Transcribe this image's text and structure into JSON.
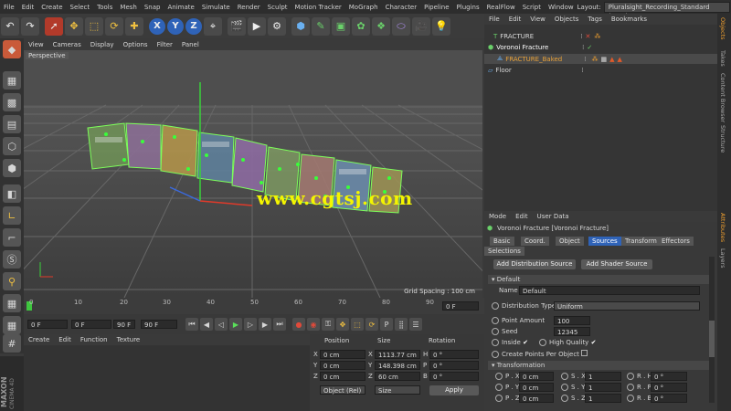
{
  "menubar": {
    "items": [
      "File",
      "Edit",
      "Create",
      "Select",
      "Tools",
      "Mesh",
      "Snap",
      "Animate",
      "Simulate",
      "Render",
      "Sculpt",
      "Motion Tracker",
      "MoGraph",
      "Character",
      "Pipeline",
      "Plugins",
      "RealFlow",
      "Script",
      "Window"
    ],
    "layout_label": "Layout:",
    "layout_value": "Pluralsight_Recording_Standard (User)"
  },
  "toolbar": {
    "x": "X",
    "y": "Y",
    "z": "Z"
  },
  "view_menu": [
    "View",
    "Cameras",
    "Display",
    "Options",
    "Filter",
    "Panel"
  ],
  "viewport": {
    "label": "Perspective",
    "grid_spacing": "Grid Spacing : 100 cm",
    "watermark": "www.cgtsj.com",
    "text3d": "FRACTURE"
  },
  "timeline": {
    "ticks": [
      "0",
      "10",
      "20",
      "30",
      "40",
      "50",
      "60",
      "70",
      "80",
      "90"
    ],
    "end_field": "0 F"
  },
  "transport": {
    "f1": "0 F",
    "f2": "0 F",
    "f3": "90 F",
    "f4": "90 F"
  },
  "material": {
    "menu": [
      "Create",
      "Edit",
      "Function",
      "Texture"
    ],
    "brand1": "MAXON",
    "brand2": "CINEMA 4D"
  },
  "coords": {
    "headers": [
      "Position",
      "Size",
      "Rotation"
    ],
    "rows": [
      {
        "a": "X",
        "p": "0 cm",
        "b": "X",
        "s": "1113.77 cm",
        "c": "H",
        "r": "0 °"
      },
      {
        "a": "Y",
        "p": "0 cm",
        "b": "Y",
        "s": "148.398 cm",
        "c": "P",
        "r": "0 °"
      },
      {
        "a": "Z",
        "p": "0 cm",
        "b": "Z",
        "s": "60 cm",
        "c": "B",
        "r": "0 °"
      }
    ],
    "mode": "Object (Rel)",
    "size_mode": "Size",
    "apply": "Apply"
  },
  "objects": {
    "menu": [
      "File",
      "Edit",
      "View",
      "Objects",
      "Tags",
      "Bookmarks"
    ],
    "items": [
      {
        "name": "FRACTURE",
        "color": "#d8d8d8"
      },
      {
        "name": "Voronoi Fracture",
        "color": "#ffffff"
      },
      {
        "name": "FRACTURE_Baked",
        "color": "#e8a23a"
      },
      {
        "name": "Floor",
        "color": "#d8d8d8"
      }
    ]
  },
  "attributes": {
    "menu": [
      "Mode",
      "Edit",
      "User Data"
    ],
    "title": "Voronoi Fracture [Voronoi Fracture]",
    "tabs": [
      "Basic",
      "Coord.",
      "Object",
      "Sources",
      "Transform",
      "Effectors",
      "Selections"
    ],
    "add_dist": "Add Distribution Source",
    "add_shader": "Add Shader Source",
    "section_default": "Default",
    "name_label": "Name",
    "name_value": "Default",
    "dist_type_label": "Distribution Type",
    "dist_type_value": "Uniform",
    "point_amount_label": "Point Amount",
    "point_amount": "100",
    "seed_label": "Seed",
    "seed": "12345",
    "inside_label": "Inside",
    "hq_label": "High Quality",
    "create_points_label": "Create Points Per Object",
    "section_transform": "Transformation",
    "tf": [
      [
        "P . X",
        "0 cm",
        "S . X",
        "1",
        "R . H",
        "0 °"
      ],
      [
        "P . Y",
        "0 cm",
        "S . Y",
        "1",
        "R . P",
        "0 °"
      ],
      [
        "P . Z",
        "0 cm",
        "S . Z",
        "1",
        "R . B",
        "0 °"
      ]
    ]
  },
  "right_tabs": [
    "Objects",
    "Takes",
    "Content Browser",
    "Structure",
    "Attributes",
    "Layers"
  ]
}
